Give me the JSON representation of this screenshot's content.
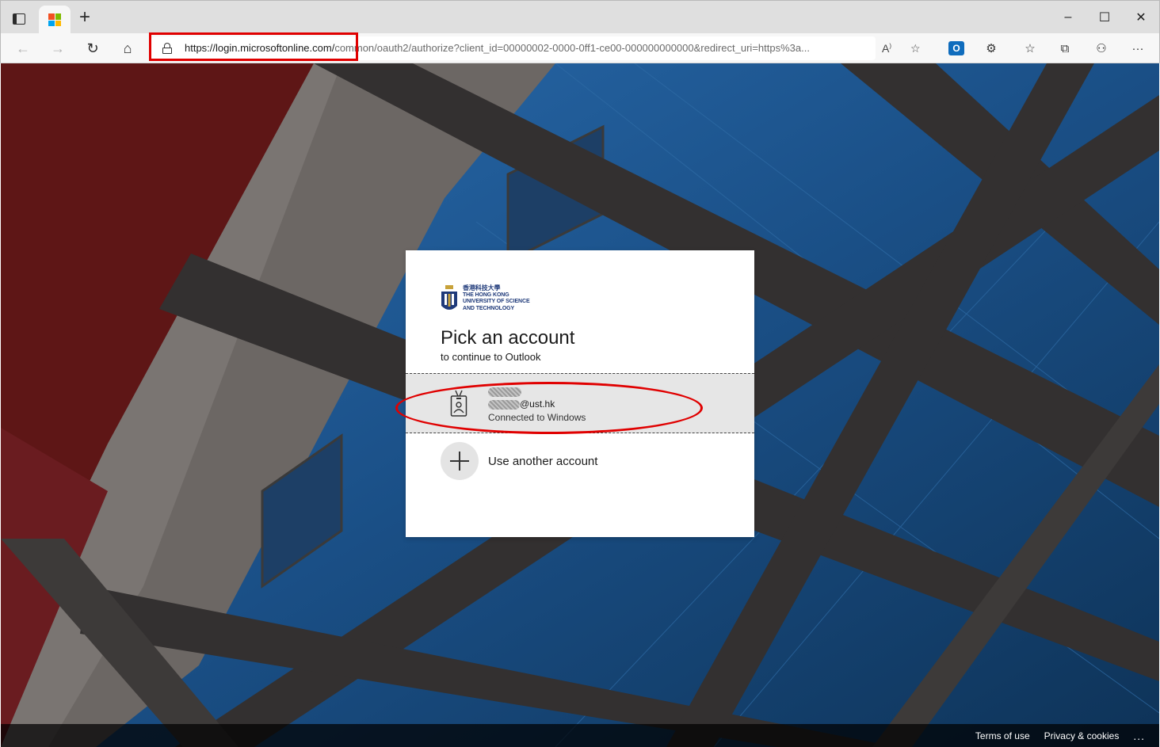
{
  "browser": {
    "tab_icon": "microsoft-logo",
    "new_tab_label": "+",
    "window_controls": {
      "minimize": "–",
      "maximize": "☐",
      "close": "✕"
    },
    "address_bar": {
      "url_host": "https://login.microsoftonline.com/",
      "url_rest": "common/oauth2/authorize?client_id=00000002-0000-0ff1-ce00-000000000000&redirect_uri=https%3a..."
    },
    "toolbar_icons": [
      "back-icon",
      "forward-icon",
      "refresh-icon",
      "home-icon",
      "read-aloud-icon",
      "favorite-add-icon",
      "outlook-icon",
      "extensions-icon",
      "favorites-icon",
      "collections-icon",
      "profile-icon",
      "more-icon"
    ],
    "highlight_color": "#e00000"
  },
  "card": {
    "logo": {
      "chinese": "香港科技大學",
      "line1": "THE HONG KONG",
      "line2": "UNIVERSITY OF SCIENCE",
      "line3": "AND TECHNOLOGY"
    },
    "title": "Pick an account",
    "subtitle": "to continue to Outlook",
    "account": {
      "email_suffix": "@ust.hk",
      "status": "Connected to Windows"
    },
    "another_account_label": "Use another account"
  },
  "footer": {
    "terms": "Terms of use",
    "privacy": "Privacy & cookies",
    "more": "..."
  }
}
